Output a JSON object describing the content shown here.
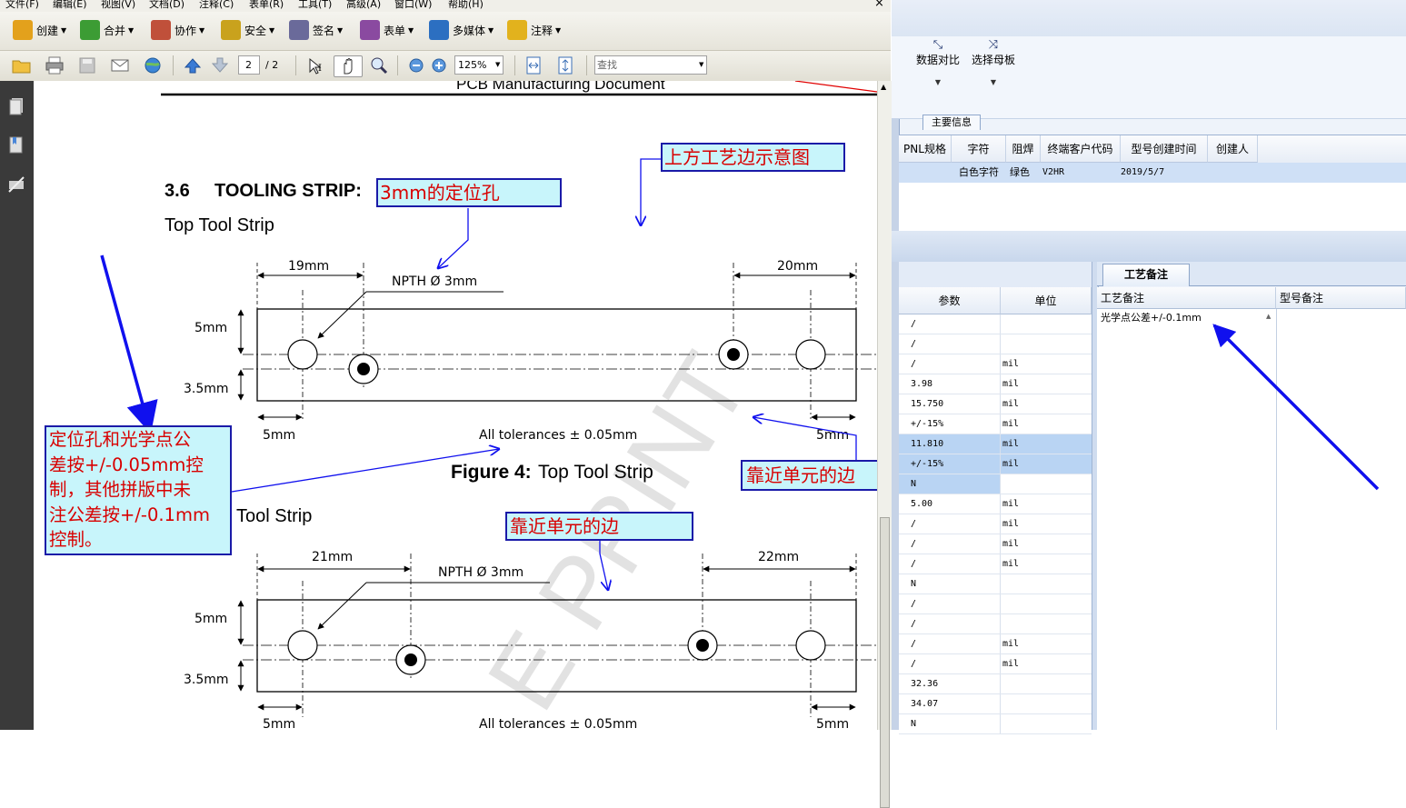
{
  "menu": [
    "文件(F)",
    "编辑(E)",
    "视图(V)",
    "文档(D)",
    "注释(C)",
    "表单(R)",
    "工具(T)",
    "高级(A)",
    "窗口(W)",
    "帮助(H)"
  ],
  "toolbar1": [
    {
      "label": "创建",
      "icon": "create-icon",
      "color": "#e3a11c"
    },
    {
      "label": "合并",
      "icon": "combine-icon",
      "color": "#3c9c34"
    },
    {
      "label": "协作",
      "icon": "collaborate-icon",
      "color": "#c0503a"
    },
    {
      "label": "安全",
      "icon": "lock-icon",
      "color": "#c9a21d"
    },
    {
      "label": "签名",
      "icon": "pen-icon",
      "color": "#6a6a9a"
    },
    {
      "label": "表单",
      "icon": "form-icon",
      "color": "#8a4aa0"
    },
    {
      "label": "多媒体",
      "icon": "multimedia-icon",
      "color": "#2c6fc1"
    },
    {
      "label": "注释",
      "icon": "comment-icon",
      "color": "#e2b21d"
    }
  ],
  "toolbar2": {
    "page_current": "2",
    "page_total": "/ 2",
    "zoom": "125%",
    "search_placeholder": "查找"
  },
  "document": {
    "header_text": "PCB Manufacturing Document",
    "section_number": "3.6",
    "section_title": "TOOLING STRIP:",
    "subtitle_top": "Top Tool Strip",
    "figure_caption_bold": "Figure 4:",
    "figure_caption_rest": " Top Tool Strip",
    "subtitle_bottom": "Tool Strip",
    "fig1": {
      "dim_left": "19mm",
      "dim_right": "20mm",
      "npth": "NPTH Ø 3mm",
      "h1": "5mm",
      "h2": "3.5mm",
      "bl": "5mm",
      "br": "5mm",
      "tol": "All tolerances ± 0.05mm"
    },
    "fig2": {
      "dim_left": "21mm",
      "dim_right": "22mm",
      "npth": "NPTH Ø 3mm",
      "h1": "5mm",
      "h2": "3.5mm",
      "bl": "5mm",
      "br": "5mm",
      "tol": "All tolerances ± 0.05mm"
    },
    "callouts": {
      "top_right": "上方工艺边示意图",
      "hole": "3mm的定位孔",
      "big": [
        "定位孔和光学点公",
        "差按+/-0.05mm控",
        "制，其他拼版中未",
        "注公差按+/-0.1mm",
        "控制。"
      ],
      "edge1": "靠近单元的边",
      "edge2": "靠近单元的边"
    },
    "watermark": "E PRINT"
  },
  "erp": {
    "ribbon": [
      {
        "label": "数据对比",
        "icon": "compare-icon"
      },
      {
        "label": "选择母板",
        "icon": "shuffle-icon"
      }
    ],
    "group_tab": "主要信息",
    "main_columns": [
      "PNL规格",
      "字符",
      "阻焊",
      "终端客户代码",
      "型号创建时间",
      "创建人"
    ],
    "main_row": [
      "",
      "白色字符",
      "绿色",
      "V2HR",
      "2019/5/7",
      ""
    ],
    "param_columns": [
      "参数",
      "单位"
    ],
    "param_rows": [
      [
        "/",
        ""
      ],
      [
        "/",
        ""
      ],
      [
        "/",
        "mil"
      ],
      [
        "3.98",
        "mil"
      ],
      [
        "15.750",
        "mil"
      ],
      [
        "+/-15%",
        "mil"
      ],
      [
        "11.810",
        "mil"
      ],
      [
        "+/-15%",
        "mil"
      ],
      [
        "N",
        ""
      ],
      [
        "5.00",
        "mil"
      ],
      [
        "/",
        "mil"
      ],
      [
        "/",
        "mil"
      ],
      [
        "/",
        "mil"
      ],
      [
        "N",
        ""
      ],
      [
        "/",
        ""
      ],
      [
        "/",
        ""
      ],
      [
        "/",
        "mil"
      ],
      [
        "/",
        "mil"
      ],
      [
        "32.36",
        ""
      ],
      [
        "34.07",
        ""
      ],
      [
        "N",
        ""
      ]
    ],
    "tab_process": "工艺备注",
    "note_columns": [
      "工艺备注",
      "型号备注"
    ],
    "note_value": "光学点公差+/-0.1mm"
  }
}
